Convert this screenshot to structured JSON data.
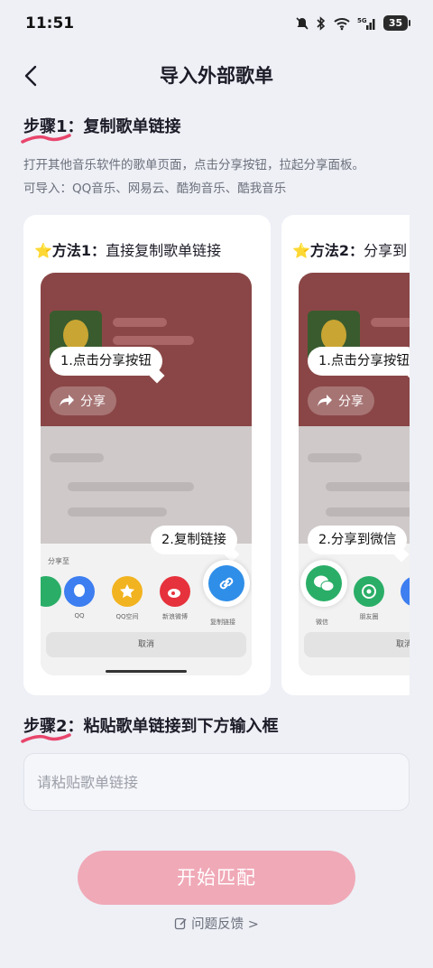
{
  "status_bar": {
    "time": "11:51",
    "battery": "35"
  },
  "header": {
    "title": "导入外部歌单"
  },
  "step1": {
    "prefix": "步骤1",
    "title": "：复制歌单链接",
    "desc_line1": "打开其他音乐软件的歌单页面，点击分享按钮，拉起分享面板。",
    "desc_line2": "可导入：QQ音乐、网易云、酷狗音乐、酷我音乐"
  },
  "methods": [
    {
      "title_strong": "⭐方法1：",
      "title_rest": "直接复制歌单链接",
      "tip1": "1.点击分享按钮",
      "share_label": "分享",
      "tip2": "2.复制链接",
      "sheet_label": "分享至",
      "apps": [
        "QQ",
        "QQ空间",
        "新浪微博",
        "复制链接"
      ],
      "cancel": "取消"
    },
    {
      "title_strong": "⭐方法2：",
      "title_rest": "分享到",
      "tip1": "1.点击分享按钮",
      "share_label": "分享",
      "tip2": "2.分享到微信",
      "apps": [
        "微信",
        "朋友圈"
      ],
      "cancel": "取消"
    }
  ],
  "step2": {
    "prefix": "步骤2",
    "title": "：粘贴歌单链接到下方输入框",
    "input_placeholder": "请粘贴歌单链接",
    "input_value": ""
  },
  "actions": {
    "start": "开始匹配",
    "feedback": "问题反馈 >"
  },
  "colors": {
    "accent": "#e8456b",
    "button": "#f0a9b7",
    "background": "#eef0f6"
  }
}
